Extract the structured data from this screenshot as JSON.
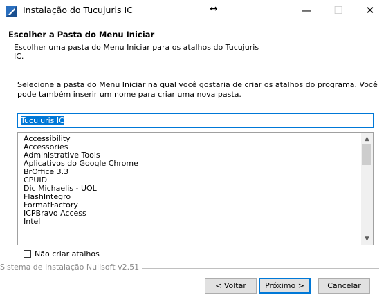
{
  "window": {
    "title": "Instalação do Tucujuris IC",
    "resize_glyph": "↔",
    "minimize_glyph": "—",
    "maximize_glyph": "☐",
    "close_glyph": "✕",
    "icon": "installer-icon"
  },
  "header": {
    "title": "Escolher a Pasta do Menu Iniciar",
    "subtitle": "Escolher uma pasta do Menu Iniciar para os atalhos do Tucujuris IC."
  },
  "body": {
    "description": "Selecione a pasta do Menu Iniciar na qual você gostaria de criar os atalhos do programa. Você pode também inserir um nome para criar uma nova pasta.",
    "folder_value": "Tucujuris IC",
    "folders": [
      "Accessibility",
      "Accessories",
      "Administrative Tools",
      "Aplicativos do Google Chrome",
      "BrOffice 3.3",
      "CPUID",
      "Dic Michaelis - UOL",
      "FlashIntegro",
      "FormatFactory",
      "ICPBravo Access",
      "Intel"
    ],
    "no_shortcuts_label": "Não criar atalhos",
    "no_shortcuts_checked": false
  },
  "footer": {
    "branding": "Sistema de Instalação Nullsoft v2.51",
    "back_label": "< Voltar",
    "next_label": "Próximo >",
    "cancel_label": "Cancelar"
  },
  "colors": {
    "accent": "#0078d7",
    "button_face": "#e1e1e1"
  }
}
